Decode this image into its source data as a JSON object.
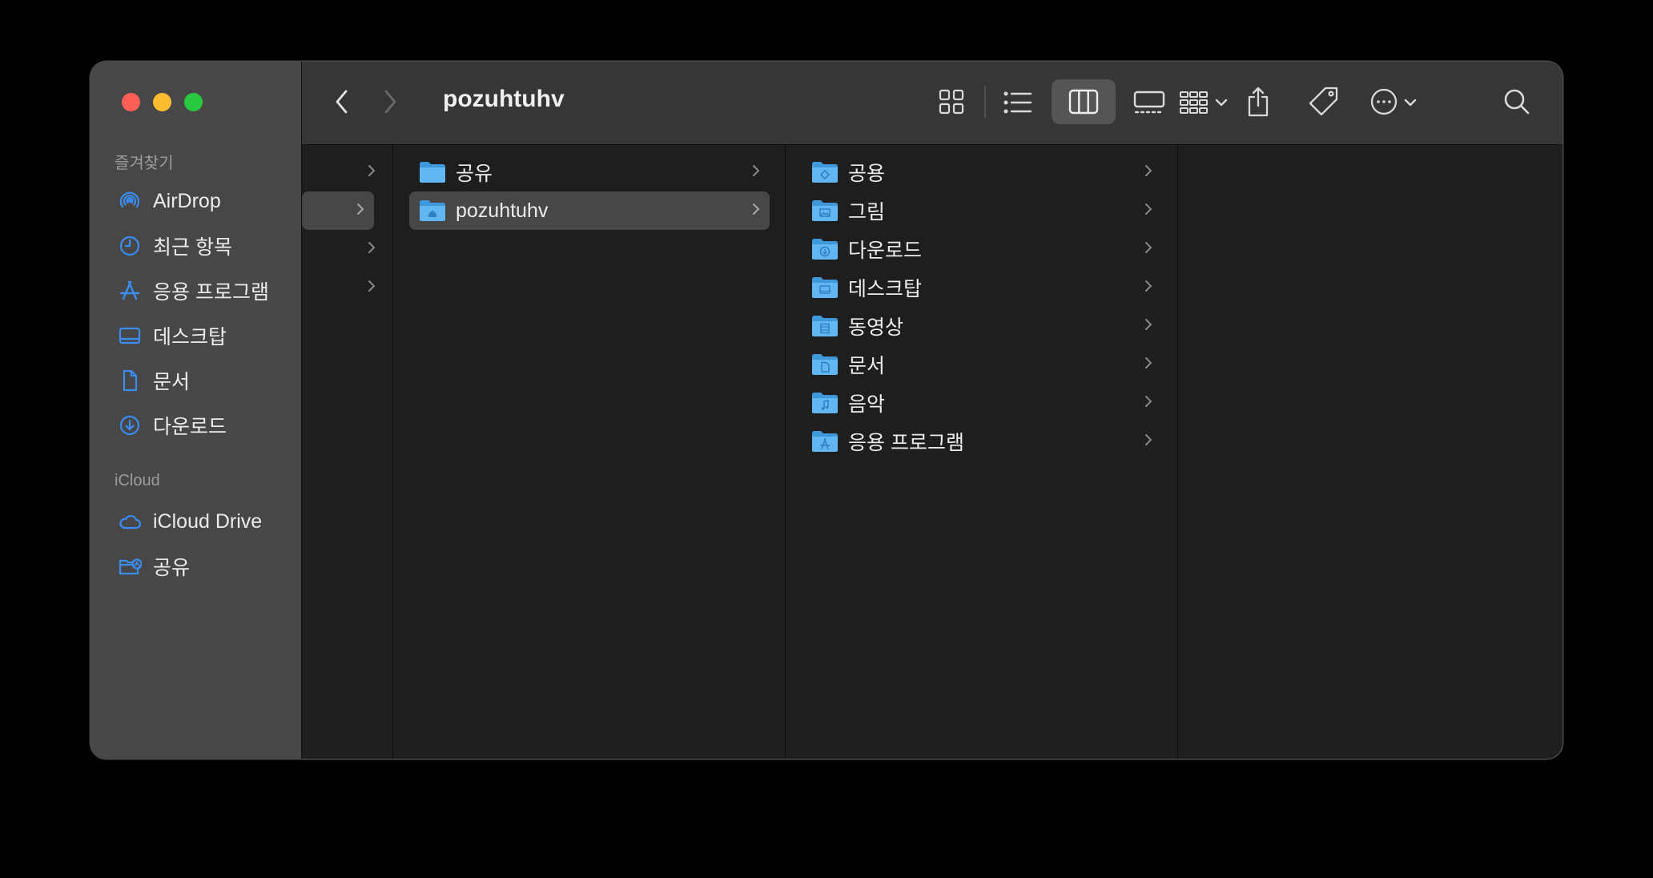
{
  "window": {
    "title": "pozuhtuhv"
  },
  "sidebar": {
    "favorites_title": "즐겨찾기",
    "favorites": [
      {
        "label": "AirDrop",
        "icon": "airdrop-icon"
      },
      {
        "label": "최근 항목",
        "icon": "clock-icon"
      },
      {
        "label": "응용 프로그램",
        "icon": "applications-icon"
      },
      {
        "label": "데스크탑",
        "icon": "desktop-icon"
      },
      {
        "label": "문서",
        "icon": "document-icon"
      },
      {
        "label": "다운로드",
        "icon": "download-icon"
      }
    ],
    "icloud_title": "iCloud",
    "icloud": [
      {
        "label": "iCloud Drive",
        "icon": "cloud-icon"
      },
      {
        "label": "공유",
        "icon": "shared-folder-icon"
      }
    ]
  },
  "toolbar": {
    "views": [
      "icon-view-icon",
      "list-view-icon",
      "column-view-icon",
      "gallery-view-icon"
    ],
    "selected_view": "column-view-icon"
  },
  "column2": [
    {
      "label": "공유",
      "selected": false
    },
    {
      "label": "pozuhtuhv",
      "selected": true
    }
  ],
  "column3": [
    {
      "label": "공용"
    },
    {
      "label": "그림"
    },
    {
      "label": "다운로드"
    },
    {
      "label": "데스크탑"
    },
    {
      "label": "동영상"
    },
    {
      "label": "문서"
    },
    {
      "label": "음악"
    },
    {
      "label": "응용 프로그램"
    }
  ],
  "colors": {
    "accent": "#3b8df5",
    "folder": "#62b7f2",
    "sidebar_bg": "#474747",
    "toolbar_bg": "#363636",
    "content_bg": "#1e1e1e"
  }
}
